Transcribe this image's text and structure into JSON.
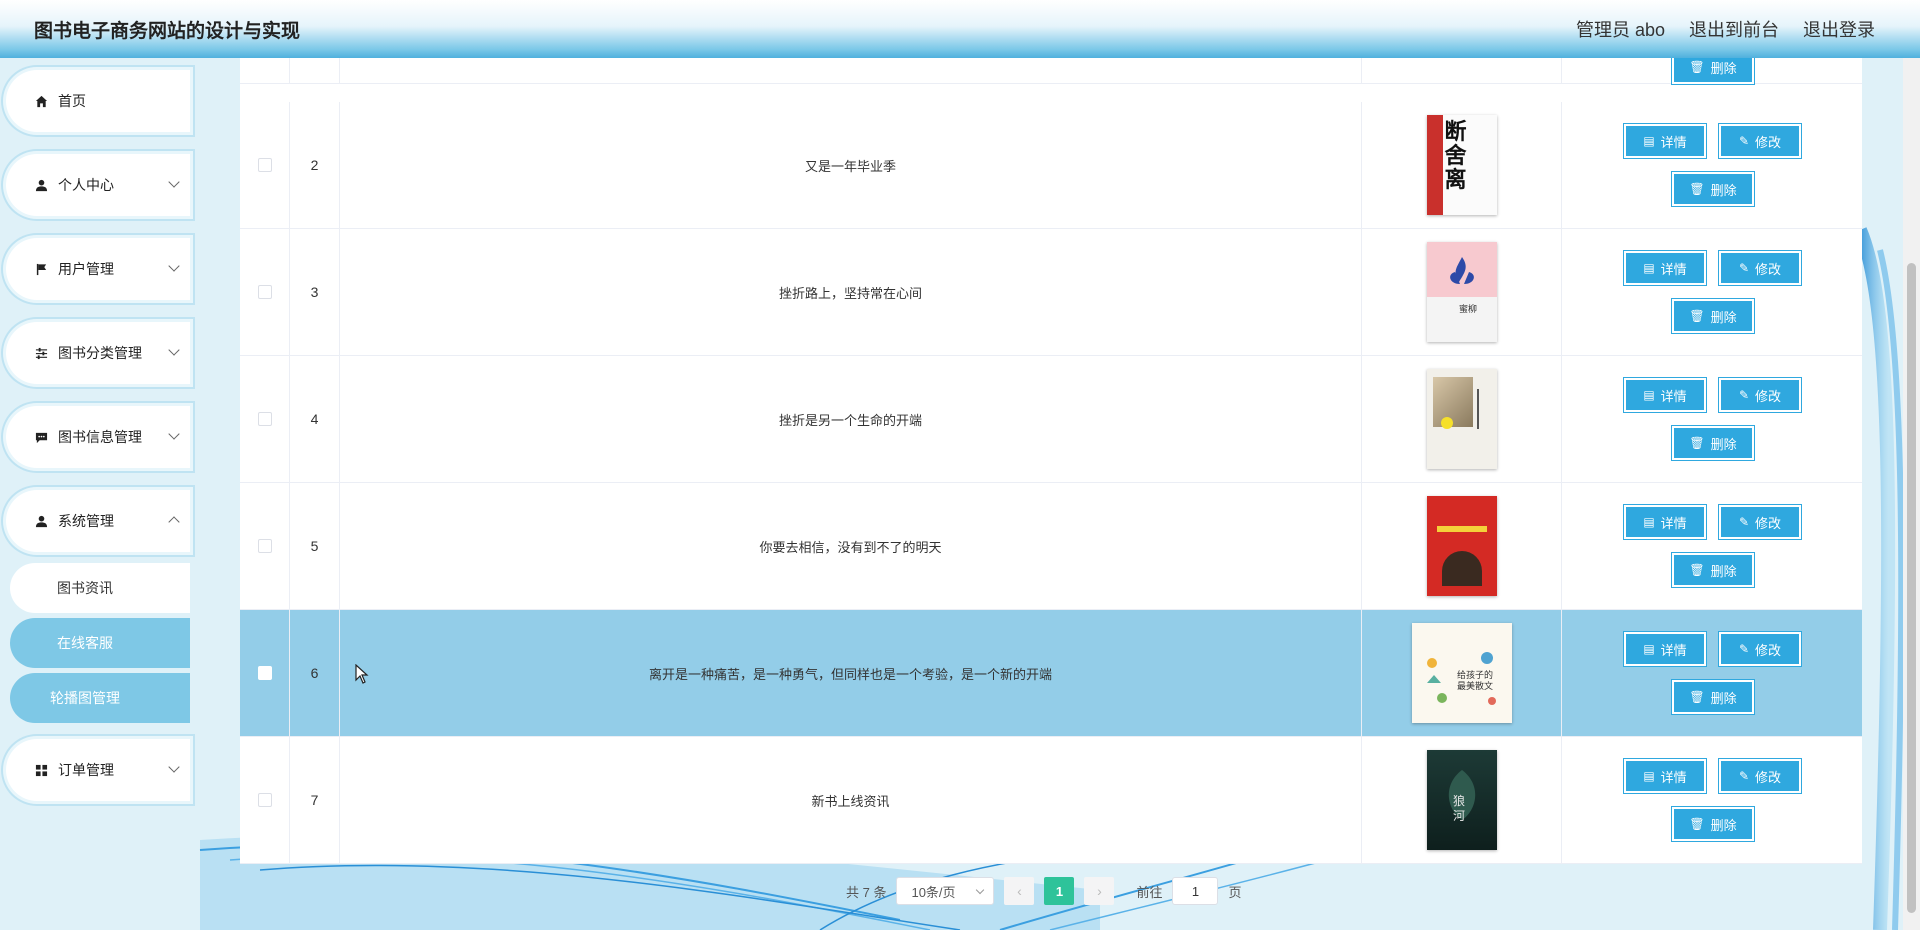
{
  "header": {
    "title": "图书电子商务网站的设计与实现",
    "admin_label": "管理员 abo",
    "back_front": "退出到前台",
    "logout": "退出登录"
  },
  "sidebar": {
    "items": [
      {
        "label": "首页",
        "icon": "home-icon"
      },
      {
        "label": "个人中心",
        "icon": "user-icon"
      },
      {
        "label": "用户管理",
        "icon": "flag-icon"
      },
      {
        "label": "图书分类管理",
        "icon": "sliders-icon"
      },
      {
        "label": "图书信息管理",
        "icon": "chat-icon"
      },
      {
        "label": "系统管理",
        "icon": "user-icon"
      },
      {
        "label": "订单管理",
        "icon": "grid-icon"
      }
    ],
    "sub_items": [
      {
        "label": "图书资讯",
        "active": false
      },
      {
        "label": "在线客服",
        "active": true
      },
      {
        "label": "轮播图管理",
        "active": true
      }
    ]
  },
  "table": {
    "rows": [
      {
        "index": "2",
        "title": "又是一年毕业季",
        "cover": "book-cover-duanshili",
        "selected": false
      },
      {
        "index": "3",
        "title": "挫折路上，坚持常在心间",
        "cover": "book-cover-pink-flower",
        "selected": false
      },
      {
        "index": "4",
        "title": "挫折是另一个生命的开端",
        "cover": "book-cover-photo",
        "selected": false
      },
      {
        "index": "5",
        "title": "你要去相信，没有到不了的明天",
        "cover": "book-cover-red",
        "selected": false
      },
      {
        "index": "6",
        "title": "离开是一种痛苦，是一种勇气，但同样也是一个考验，是一个新的开端",
        "cover": "book-cover-illustrated",
        "selected": true
      },
      {
        "index": "7",
        "title": "新书上线资讯",
        "cover": "book-cover-dark-green",
        "selected": false
      }
    ],
    "buttons": {
      "detail": "详情",
      "edit": "修改",
      "delete": "删除"
    }
  },
  "pagination": {
    "total": "共 7 条",
    "page_size": "10条/页",
    "current_page": "1",
    "goto_label": "前往",
    "goto_value": "1",
    "page_suffix": "页"
  },
  "colors": {
    "accent": "#2fa8df",
    "selected_row": "#93cde8",
    "active_page": "#2ec39a",
    "submenu_active": "#7ec8e6"
  }
}
